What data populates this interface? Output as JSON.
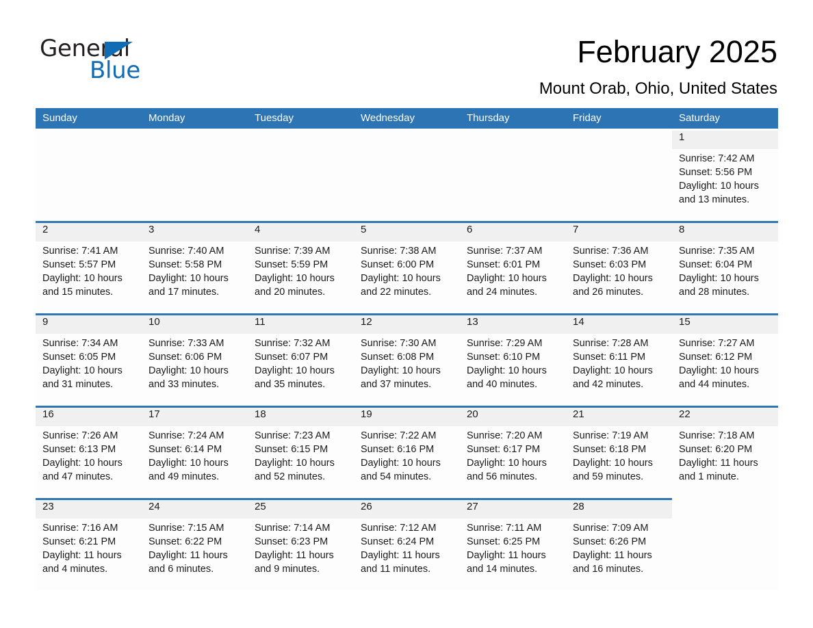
{
  "logo": {
    "word_top": "General",
    "word_bottom": "Blue",
    "triangle_color": "#0f6cb5"
  },
  "header": {
    "title": "February 2025",
    "subtitle": "Mount Orab, Ohio, United States"
  },
  "theme": {
    "header_blue": "#2c74b3",
    "date_strip_gray": "#f0f0f0",
    "cell_white": "#fdfdfd",
    "text_black": "#1a1a1a"
  },
  "calendar": {
    "weekday_headers": [
      "Sunday",
      "Monday",
      "Tuesday",
      "Wednesday",
      "Thursday",
      "Friday",
      "Saturday"
    ],
    "weeks": [
      [
        {
          "date": "",
          "sunrise": "",
          "sunset": "",
          "daylight1": "",
          "daylight2": ""
        },
        {
          "date": "",
          "sunrise": "",
          "sunset": "",
          "daylight1": "",
          "daylight2": ""
        },
        {
          "date": "",
          "sunrise": "",
          "sunset": "",
          "daylight1": "",
          "daylight2": ""
        },
        {
          "date": "",
          "sunrise": "",
          "sunset": "",
          "daylight1": "",
          "daylight2": ""
        },
        {
          "date": "",
          "sunrise": "",
          "sunset": "",
          "daylight1": "",
          "daylight2": ""
        },
        {
          "date": "",
          "sunrise": "",
          "sunset": "",
          "daylight1": "",
          "daylight2": ""
        },
        {
          "date": "1",
          "sunrise": "Sunrise: 7:42 AM",
          "sunset": "Sunset: 5:56 PM",
          "daylight1": "Daylight: 10 hours",
          "daylight2": "and 13 minutes."
        }
      ],
      [
        {
          "date": "2",
          "sunrise": "Sunrise: 7:41 AM",
          "sunset": "Sunset: 5:57 PM",
          "daylight1": "Daylight: 10 hours",
          "daylight2": "and 15 minutes."
        },
        {
          "date": "3",
          "sunrise": "Sunrise: 7:40 AM",
          "sunset": "Sunset: 5:58 PM",
          "daylight1": "Daylight: 10 hours",
          "daylight2": "and 17 minutes."
        },
        {
          "date": "4",
          "sunrise": "Sunrise: 7:39 AM",
          "sunset": "Sunset: 5:59 PM",
          "daylight1": "Daylight: 10 hours",
          "daylight2": "and 20 minutes."
        },
        {
          "date": "5",
          "sunrise": "Sunrise: 7:38 AM",
          "sunset": "Sunset: 6:00 PM",
          "daylight1": "Daylight: 10 hours",
          "daylight2": "and 22 minutes."
        },
        {
          "date": "6",
          "sunrise": "Sunrise: 7:37 AM",
          "sunset": "Sunset: 6:01 PM",
          "daylight1": "Daylight: 10 hours",
          "daylight2": "and 24 minutes."
        },
        {
          "date": "7",
          "sunrise": "Sunrise: 7:36 AM",
          "sunset": "Sunset: 6:03 PM",
          "daylight1": "Daylight: 10 hours",
          "daylight2": "and 26 minutes."
        },
        {
          "date": "8",
          "sunrise": "Sunrise: 7:35 AM",
          "sunset": "Sunset: 6:04 PM",
          "daylight1": "Daylight: 10 hours",
          "daylight2": "and 28 minutes."
        }
      ],
      [
        {
          "date": "9",
          "sunrise": "Sunrise: 7:34 AM",
          "sunset": "Sunset: 6:05 PM",
          "daylight1": "Daylight: 10 hours",
          "daylight2": "and 31 minutes."
        },
        {
          "date": "10",
          "sunrise": "Sunrise: 7:33 AM",
          "sunset": "Sunset: 6:06 PM",
          "daylight1": "Daylight: 10 hours",
          "daylight2": "and 33 minutes."
        },
        {
          "date": "11",
          "sunrise": "Sunrise: 7:32 AM",
          "sunset": "Sunset: 6:07 PM",
          "daylight1": "Daylight: 10 hours",
          "daylight2": "and 35 minutes."
        },
        {
          "date": "12",
          "sunrise": "Sunrise: 7:30 AM",
          "sunset": "Sunset: 6:08 PM",
          "daylight1": "Daylight: 10 hours",
          "daylight2": "and 37 minutes."
        },
        {
          "date": "13",
          "sunrise": "Sunrise: 7:29 AM",
          "sunset": "Sunset: 6:10 PM",
          "daylight1": "Daylight: 10 hours",
          "daylight2": "and 40 minutes."
        },
        {
          "date": "14",
          "sunrise": "Sunrise: 7:28 AM",
          "sunset": "Sunset: 6:11 PM",
          "daylight1": "Daylight: 10 hours",
          "daylight2": "and 42 minutes."
        },
        {
          "date": "15",
          "sunrise": "Sunrise: 7:27 AM",
          "sunset": "Sunset: 6:12 PM",
          "daylight1": "Daylight: 10 hours",
          "daylight2": "and 44 minutes."
        }
      ],
      [
        {
          "date": "16",
          "sunrise": "Sunrise: 7:26 AM",
          "sunset": "Sunset: 6:13 PM",
          "daylight1": "Daylight: 10 hours",
          "daylight2": "and 47 minutes."
        },
        {
          "date": "17",
          "sunrise": "Sunrise: 7:24 AM",
          "sunset": "Sunset: 6:14 PM",
          "daylight1": "Daylight: 10 hours",
          "daylight2": "and 49 minutes."
        },
        {
          "date": "18",
          "sunrise": "Sunrise: 7:23 AM",
          "sunset": "Sunset: 6:15 PM",
          "daylight1": "Daylight: 10 hours",
          "daylight2": "and 52 minutes."
        },
        {
          "date": "19",
          "sunrise": "Sunrise: 7:22 AM",
          "sunset": "Sunset: 6:16 PM",
          "daylight1": "Daylight: 10 hours",
          "daylight2": "and 54 minutes."
        },
        {
          "date": "20",
          "sunrise": "Sunrise: 7:20 AM",
          "sunset": "Sunset: 6:17 PM",
          "daylight1": "Daylight: 10 hours",
          "daylight2": "and 56 minutes."
        },
        {
          "date": "21",
          "sunrise": "Sunrise: 7:19 AM",
          "sunset": "Sunset: 6:18 PM",
          "daylight1": "Daylight: 10 hours",
          "daylight2": "and 59 minutes."
        },
        {
          "date": "22",
          "sunrise": "Sunrise: 7:18 AM",
          "sunset": "Sunset: 6:20 PM",
          "daylight1": "Daylight: 11 hours",
          "daylight2": "and 1 minute."
        }
      ],
      [
        {
          "date": "23",
          "sunrise": "Sunrise: 7:16 AM",
          "sunset": "Sunset: 6:21 PM",
          "daylight1": "Daylight: 11 hours",
          "daylight2": "and 4 minutes."
        },
        {
          "date": "24",
          "sunrise": "Sunrise: 7:15 AM",
          "sunset": "Sunset: 6:22 PM",
          "daylight1": "Daylight: 11 hours",
          "daylight2": "and 6 minutes."
        },
        {
          "date": "25",
          "sunrise": "Sunrise: 7:14 AM",
          "sunset": "Sunset: 6:23 PM",
          "daylight1": "Daylight: 11 hours",
          "daylight2": "and 9 minutes."
        },
        {
          "date": "26",
          "sunrise": "Sunrise: 7:12 AM",
          "sunset": "Sunset: 6:24 PM",
          "daylight1": "Daylight: 11 hours",
          "daylight2": "and 11 minutes."
        },
        {
          "date": "27",
          "sunrise": "Sunrise: 7:11 AM",
          "sunset": "Sunset: 6:25 PM",
          "daylight1": "Daylight: 11 hours",
          "daylight2": "and 14 minutes."
        },
        {
          "date": "28",
          "sunrise": "Sunrise: 7:09 AM",
          "sunset": "Sunset: 6:26 PM",
          "daylight1": "Daylight: 11 hours",
          "daylight2": "and 16 minutes."
        },
        {
          "date": "",
          "sunrise": "",
          "sunset": "",
          "daylight1": "",
          "daylight2": ""
        }
      ]
    ]
  }
}
